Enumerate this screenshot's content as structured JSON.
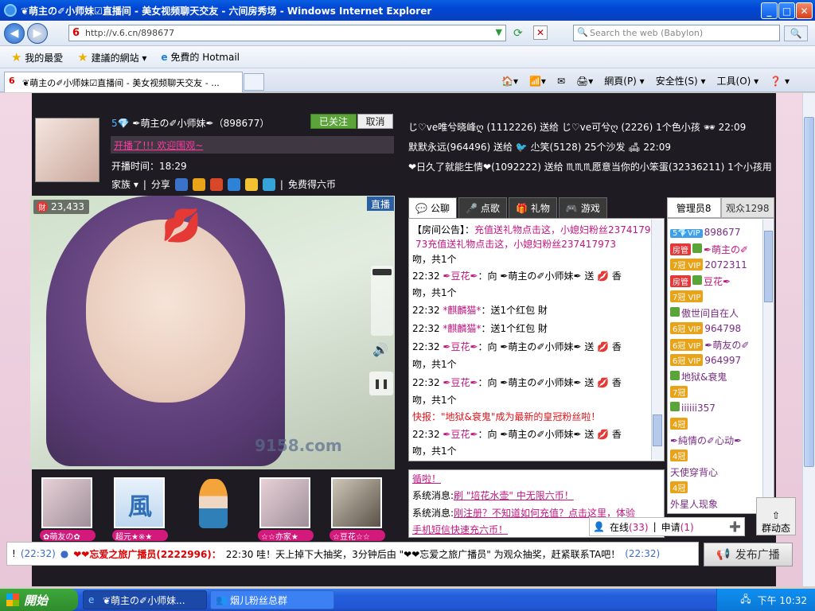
{
  "window": {
    "title": "❦萌主の✐小师妹☑直播间 - 美女视频聊天交友 - 六间房秀场 - Windows Internet Explorer",
    "minimize": "_",
    "maximize": "□",
    "close": "✕"
  },
  "browser": {
    "address": "http://v.6.cn/898677",
    "search_placeholder": "Search the web (Babylon)",
    "favorites": [
      "我的最愛",
      "建議的網站 ▾",
      "免費的 Hotmail"
    ],
    "tab_title": "❦萌主の✐小师妹☑直播间 - 美女视频聊天交友 - ...",
    "commands": [
      "網頁(P) ▾",
      "安全性(S) ▾",
      "工具(O) ▾",
      "❓ ▾"
    ]
  },
  "anchor": {
    "level": "5💎",
    "name": "✒萌主の✐小师妹✒（898677）",
    "follow_label": "已关注",
    "cancel_label": "取消",
    "slogan": "开播了!!! 欢迎围观~",
    "open_time": "开播时间：18:29",
    "family_label": "家族",
    "share_label": "分享",
    "free_label": "免费得六币"
  },
  "video": {
    "viewers": "23,433",
    "live_label": "直播",
    "watermark": "9158.com"
  },
  "bottom_users": [
    {
      "label": "✿萌友の✿"
    },
    {
      "label": "超元★※★"
    },
    {
      "label": ""
    },
    {
      "label": "☆☆亦家★"
    },
    {
      "label": "☆豆花☆☆"
    }
  ],
  "gift_feed": [
    "じ♡ve唯兮晓峰ღ (1112226) 送给 じ♡ve可兮ღ (2226) 1个色小孩 🕶 22:09",
    "默默永远(964496) 送给 🐦 尐笑(5128) 25个沙发 🛋 22:09",
    "❤日久了就能生情❤(1092222) 送给 ♏♏♏愿意当你的小笨蛋(32336211) 1个小孩用"
  ],
  "chat_tabs": [
    "公聊",
    "点歌",
    "礼物",
    "游戏"
  ],
  "chat": {
    "notice_label": "【房间公告】：",
    "notice_text": "充值送礼物点击这，小媳妇粉丝2374179",
    "notice_text2": "73充值送礼物点击这，小媳妇粉丝237417973",
    "lines": [
      {
        "time": "",
        "text": "吻，共1个"
      },
      {
        "time": "22:32",
        "who": "✒豆花✒",
        "text": "：向 ✒萌主の✐小师妹✒ 送 💋 香"
      },
      {
        "time": "",
        "text": "吻，共1个"
      },
      {
        "time": "22:32",
        "who": "*麒麟猫*",
        "text": "：送1个红包 財"
      },
      {
        "time": "22:32",
        "who": "*麒麟猫*",
        "text": "：送1个红包 財"
      },
      {
        "time": "22:32",
        "who": "✒豆花✒",
        "text": "：向 ✒萌主の✐小师妹✒ 送 💋 香"
      },
      {
        "time": "",
        "text": "吻，共1个"
      },
      {
        "time": "22:32",
        "who": "✒豆花✒",
        "text": "：向 ✒萌主の✐小师妹✒ 送 💋 香"
      },
      {
        "time": "",
        "text": "吻，共1个"
      },
      {
        "time": "",
        "alert": "快报：\"地狱&衰鬼\"成为最新的皇冠粉丝啦！"
      },
      {
        "time": "22:32",
        "who": "✒豆花✒",
        "text": "：向 ✒萌主の✐小师妹✒ 送 💋 香"
      },
      {
        "time": "",
        "text": "吻，共1个"
      }
    ]
  },
  "system": {
    "lines": [
      {
        "prefix": "",
        "text": "循啦！"
      },
      {
        "prefix": "系统消息:",
        "text": "刷 \"培花水壶\" 中无限六币！"
      },
      {
        "prefix": "系统消息:",
        "text": "刚注册？不知道如何充值？点击这里，体验"
      },
      {
        "prefix": "",
        "text": "手机短信快速充六币！"
      }
    ]
  },
  "users": {
    "tabs": [
      "管理员8",
      "观众1298"
    ],
    "list": [
      {
        "lvl": "5💎VIP",
        "name": "898677"
      },
      {
        "lvl": "房管",
        "name": "✒萌主の✐"
      },
      {
        "lvl": "7冠 VIP",
        "name": "2072311"
      },
      {
        "lvl": "房管",
        "name": "豆花✒"
      },
      {
        "lvl": "7冠 VIP",
        "name": ""
      },
      {
        "lvl": "",
        "name": "傲世间自在人"
      },
      {
        "lvl": "6冠 VIP",
        "name": "964798"
      },
      {
        "lvl": "6冠 VIP",
        "name": "✒萌友の✐"
      },
      {
        "lvl": "6冠 VIP",
        "name": "964997"
      },
      {
        "lvl": "",
        "name": "地狱&衰鬼"
      },
      {
        "lvl": "7冠",
        "name": ""
      },
      {
        "lvl": "",
        "name": "iiiiii357"
      },
      {
        "lvl": "4冠",
        "name": ""
      },
      {
        "lvl": "",
        "name": "✒純情の✐心动✒"
      },
      {
        "lvl": "4冠",
        "name": ""
      },
      {
        "lvl": "",
        "name": "天使穿背心"
      },
      {
        "lvl": "4冠",
        "name": ""
      },
      {
        "lvl": "",
        "name": "外星人现象"
      }
    ],
    "online_label": "在线",
    "online_count": "(33)",
    "apply_label": "申请",
    "apply_count": "(1)",
    "group_label": "群动态"
  },
  "broadcast": {
    "time1": "(22:32)",
    "sender": "❤❤忘爱之旅广播员(2222996)：",
    "text": "22:30 哇！天上掉下大抽奖，3分钟后由 \"❤❤忘爱之旅广播员\" 为观众抽奖，赶紧联系TA吧！",
    "time2": "(22:32)",
    "button_label": "发布广播"
  },
  "taskbar": {
    "start_label": "開始",
    "tasks": [
      "❦萌主の✐小师妹...",
      "烟儿粉丝总群"
    ],
    "clock": "下午 10:32"
  }
}
